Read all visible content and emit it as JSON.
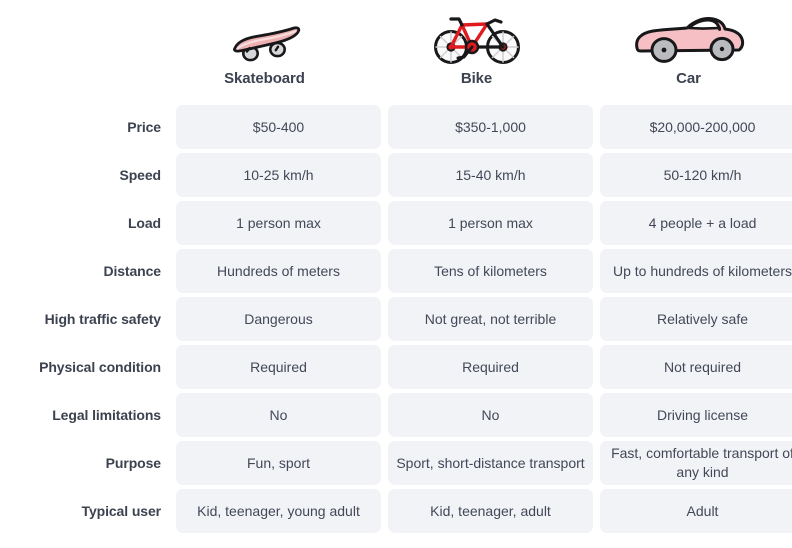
{
  "colors": {
    "cell_background": "#f2f3f7",
    "text": "#3c4250",
    "cell_text": "#424857",
    "page_background": "#ffffff",
    "skateboard_accent": "#eeb0b0",
    "bike_accent": "#e01b20",
    "car_accent": "#f5bfc3"
  },
  "columns": [
    {
      "id": "skateboard",
      "label": "Skateboard",
      "icon": "skateboard-icon"
    },
    {
      "id": "bike",
      "label": "Bike",
      "icon": "bike-icon"
    },
    {
      "id": "car",
      "label": "Car",
      "icon": "car-icon"
    }
  ],
  "rows": [
    {
      "label": "Price",
      "values": [
        "$50-400",
        "$350-1,000",
        "$20,000-200,000"
      ]
    },
    {
      "label": "Speed",
      "values": [
        "10-25 km/h",
        "15-40 km/h",
        "50-120 km/h"
      ]
    },
    {
      "label": "Load",
      "values": [
        "1 person max",
        "1 person max",
        "4 people + a load"
      ]
    },
    {
      "label": "Distance",
      "values": [
        "Hundreds of meters",
        "Tens of kilometers",
        "Up to hundreds of kilometers"
      ]
    },
    {
      "label": "High traffic safety",
      "values": [
        "Dangerous",
        "Not great, not terrible",
        "Relatively safe"
      ]
    },
    {
      "label": "Physical condition",
      "values": [
        "Required",
        "Required",
        "Not required"
      ]
    },
    {
      "label": "Legal limitations",
      "values": [
        "No",
        "No",
        "Driving license"
      ]
    },
    {
      "label": "Purpose",
      "values": [
        "Fun, sport",
        "Sport, short-distance transport",
        "Fast, comfortable transport of any kind"
      ]
    },
    {
      "label": "Typical user",
      "values": [
        "Kid, teenager, young adult",
        "Kid, teenager, adult",
        "Adult"
      ]
    }
  ]
}
